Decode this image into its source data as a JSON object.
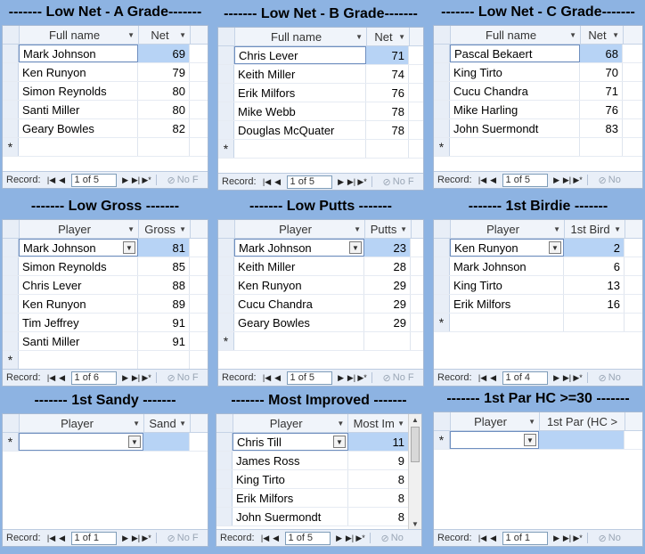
{
  "panels": [
    {
      "title": "------- Low Net - A Grade-------",
      "columns": [
        "Full name",
        "Net"
      ],
      "rows": [
        [
          "Mark Johnson",
          "69"
        ],
        [
          "Ken Runyon",
          "79"
        ],
        [
          "Simon Reynolds",
          "80"
        ],
        [
          "Santi Miller",
          "80"
        ],
        [
          "Geary Bowles",
          "82"
        ]
      ],
      "record_label": "Record:",
      "record_pos": "1 of 5",
      "filter_label": "No F"
    },
    {
      "title": "------- Low Net - B Grade-------",
      "columns": [
        "Full name",
        "Net"
      ],
      "rows": [
        [
          "Chris Lever",
          "71"
        ],
        [
          "Keith Miller",
          "74"
        ],
        [
          "Erik Milfors",
          "76"
        ],
        [
          "Mike Webb",
          "78"
        ],
        [
          "Douglas McQuater",
          "78"
        ]
      ],
      "record_label": "Record:",
      "record_pos": "1 of 5",
      "filter_label": "No F"
    },
    {
      "title": "------- Low Net - C Grade-------",
      "columns": [
        "Full name",
        "Net"
      ],
      "rows": [
        [
          "Pascal Bekaert",
          "68"
        ],
        [
          "King Tirto",
          "70"
        ],
        [
          "Cucu Chandra",
          "71"
        ],
        [
          "Mike Harling",
          "76"
        ],
        [
          "John Suermondt",
          "83"
        ]
      ],
      "record_label": "Record:",
      "record_pos": "1 of 5",
      "filter_label": "No"
    },
    {
      "title": "------- Low Gross -------",
      "columns": [
        "Player",
        "Gross"
      ],
      "rows": [
        [
          "Mark Johnson",
          "81"
        ],
        [
          "Simon Reynolds",
          "85"
        ],
        [
          "Chris Lever",
          "88"
        ],
        [
          "Ken Runyon",
          "89"
        ],
        [
          "Tim Jeffrey",
          "91"
        ],
        [
          "Santi Miller",
          "91"
        ]
      ],
      "record_label": "Record:",
      "record_pos": "1 of 6",
      "filter_label": "No F"
    },
    {
      "title": "------- Low Putts -------",
      "columns": [
        "Player",
        "Putts"
      ],
      "rows": [
        [
          "Mark Johnson",
          "23"
        ],
        [
          "Keith Miller",
          "28"
        ],
        [
          "Ken Runyon",
          "29"
        ],
        [
          "Cucu Chandra",
          "29"
        ],
        [
          "Geary Bowles",
          "29"
        ]
      ],
      "record_label": "Record:",
      "record_pos": "1 of 5",
      "filter_label": "No F"
    },
    {
      "title": "------- 1st Birdie -------",
      "columns": [
        "Player",
        "1st Bird"
      ],
      "rows": [
        [
          "Ken Runyon",
          "2"
        ],
        [
          "Mark Johnson",
          "6"
        ],
        [
          "King Tirto",
          "13"
        ],
        [
          "Erik Milfors",
          "16"
        ]
      ],
      "record_label": "Record:",
      "record_pos": "1 of 4",
      "filter_label": "No"
    },
    {
      "title": "------- 1st Sandy -------",
      "columns": [
        "Player",
        "Sand"
      ],
      "rows": [],
      "record_label": "Record:",
      "record_pos": "1 of 1",
      "filter_label": "No F"
    },
    {
      "title": "------- Most Improved -------",
      "columns": [
        "Player",
        "Most Im"
      ],
      "rows": [
        [
          "Chris Till",
          "11"
        ],
        [
          "James Ross",
          "9"
        ],
        [
          "King Tirto",
          "8"
        ],
        [
          "Erik Milfors",
          "8"
        ],
        [
          "John Suermondt",
          "8"
        ]
      ],
      "record_label": "Record:",
      "record_pos": "1 of 5",
      "filter_label": "No"
    },
    {
      "title": "------- 1st Par HC >=30 -------",
      "columns": [
        "Player",
        "1st Par (HC >"
      ],
      "rows": [],
      "record_label": "Record:",
      "record_pos": "1 of 1",
      "filter_label": "No"
    }
  ],
  "nav_icons": {
    "first": "first-record-icon",
    "prev": "previous-record-icon",
    "next": "next-record-icon",
    "last": "last-record-icon",
    "new": "new-record-icon",
    "filter": "filter-icon"
  },
  "new_row_marker": "*",
  "colors": {
    "background": "#8db3e2",
    "highlight": "#b7d3f5"
  }
}
